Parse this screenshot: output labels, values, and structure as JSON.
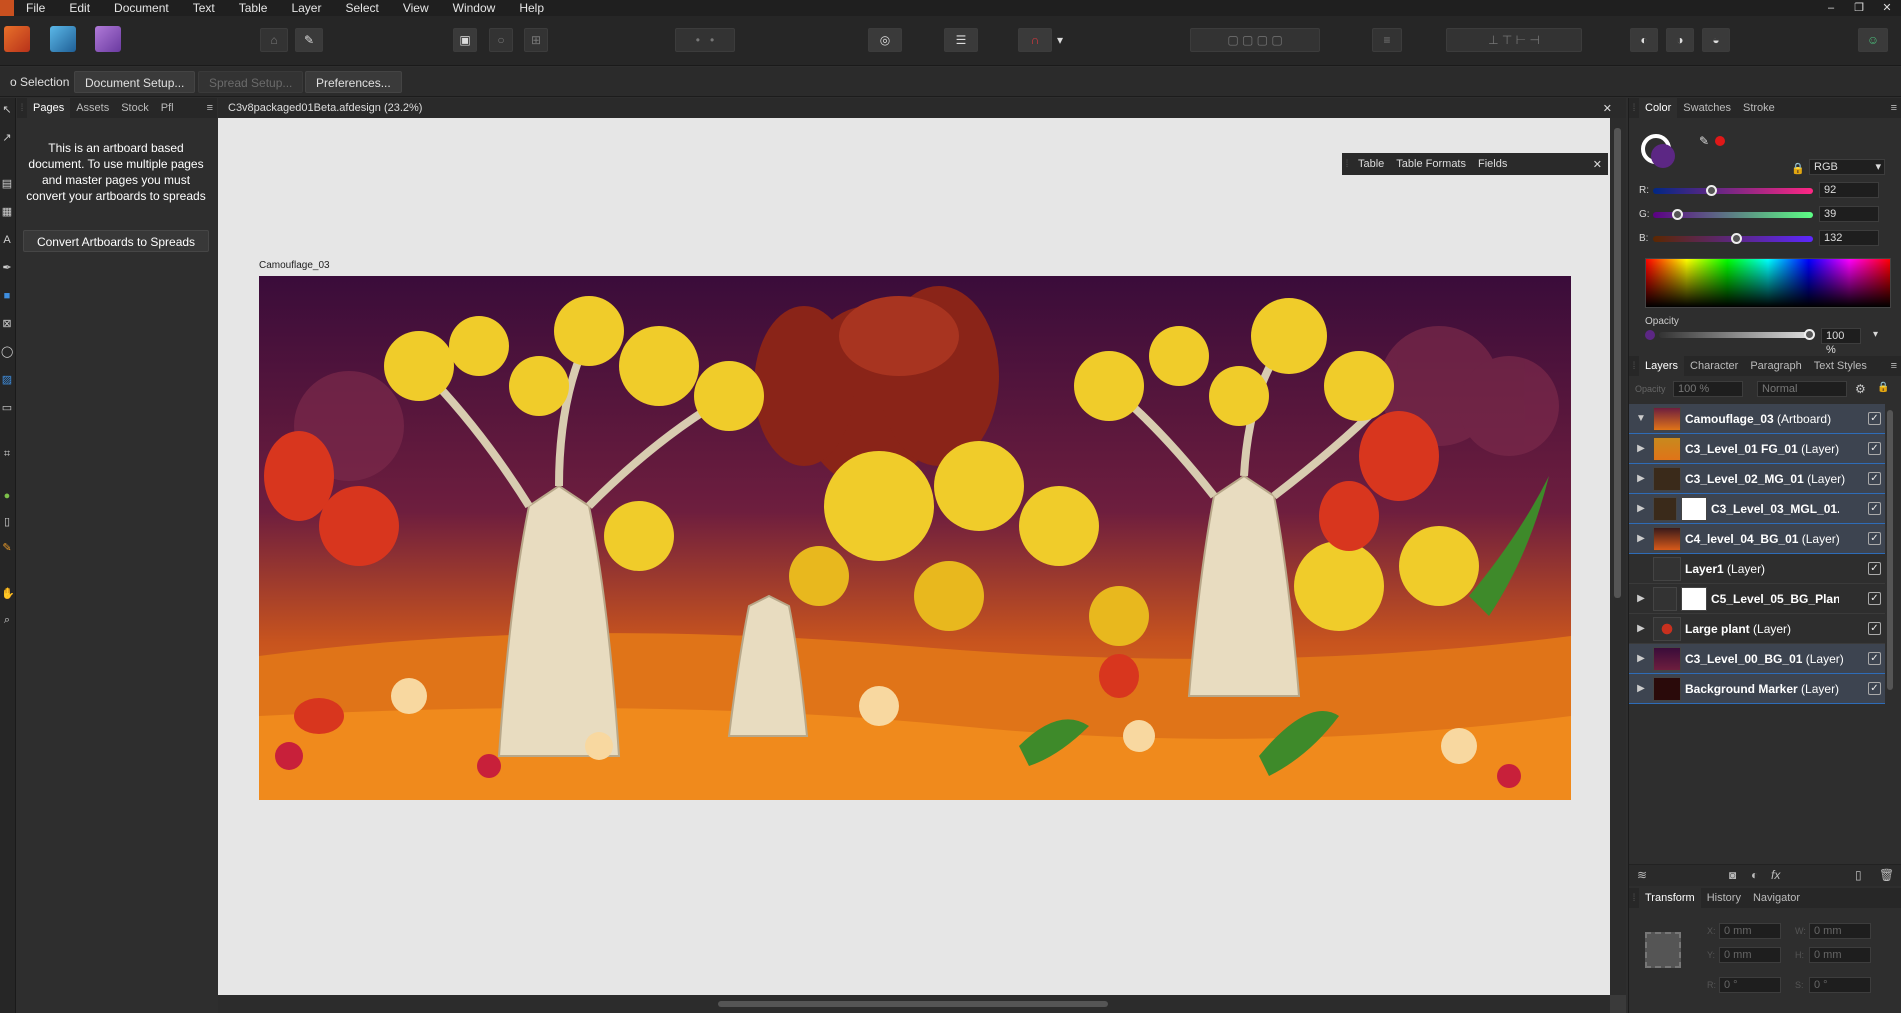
{
  "menu": {
    "items": [
      "File",
      "Edit",
      "Document",
      "Text",
      "Table",
      "Layer",
      "Select",
      "View",
      "Window",
      "Help"
    ]
  },
  "window_controls": {
    "minimize": "–",
    "restore": "❐",
    "close": "✕"
  },
  "context_bar": {
    "selection_label": "o Selection",
    "document_setup": "Document Setup...",
    "spread_setup": "Spread Setup...",
    "preferences": "Preferences..."
  },
  "left_panel": {
    "tabs": [
      "Pages",
      "Assets",
      "Stock",
      "Pfl"
    ],
    "message": "This is an artboard based document. To use multiple pages and master pages you must convert your artboards to spreads",
    "convert_button": "Convert Artboards to Spreads"
  },
  "document": {
    "tab_title": "C3v8packaged01Beta.afdesign (23.2%)",
    "artboard_label": "Camouflage_03"
  },
  "floating_panel": {
    "tabs": [
      "Table",
      "Table Formats",
      "Fields"
    ]
  },
  "color_panel": {
    "tabs": [
      "Color",
      "Swatches",
      "Stroke"
    ],
    "mode": "RGB",
    "r_label": "R:",
    "r_value": "92",
    "g_label": "G:",
    "g_value": "39",
    "b_label": "B:",
    "b_value": "132",
    "r": 92,
    "g": 39,
    "b": 132,
    "opacity_label": "Opacity",
    "opacity_value": "100 %",
    "fill_color": "#5c2784"
  },
  "layers_panel": {
    "tabs": [
      "Layers",
      "Character",
      "Paragraph",
      "Text Styles"
    ],
    "opacity_field": "100 %",
    "blend_mode": "Normal",
    "opacity_label": "Opacity",
    "layers": [
      {
        "name": "Camouflage_03",
        "type": "(Artboard)",
        "expanded": true
      },
      {
        "name": "C3_Level_01 FG_01",
        "type": "(Layer)"
      },
      {
        "name": "C3_Level_02_MG_01",
        "type": "(Layer)"
      },
      {
        "name": "C3_Level_03_MGL_01...",
        "type": ""
      },
      {
        "name": "C4_level_04_BG_01",
        "type": "(Layer)"
      },
      {
        "name": "Layer1",
        "type": "(Layer)"
      },
      {
        "name": "C5_Level_05_BG_Plan...",
        "type": ""
      },
      {
        "name": "Large plant",
        "type": "(Layer)"
      },
      {
        "name": "C3_Level_00_BG_01",
        "type": "(Layer)"
      },
      {
        "name": "Background Marker",
        "type": "(Layer)"
      }
    ]
  },
  "transform_panel": {
    "tabs": [
      "Transform",
      "History",
      "Navigator"
    ],
    "x_label": "X:",
    "x_value": "0 mm",
    "y_label": "Y:",
    "y_value": "0 mm",
    "w_label": "W:",
    "w_value": "0 mm",
    "h_label": "H:",
    "h_value": "0 mm",
    "r_label": "R:",
    "r_value": "0 °",
    "s_label": "S:",
    "s_value": "0 °"
  },
  "icons": {
    "check": "✓",
    "expand": "▶",
    "collapse": "▼",
    "dropdown": "▾",
    "close": "✕",
    "menu": "≡"
  }
}
